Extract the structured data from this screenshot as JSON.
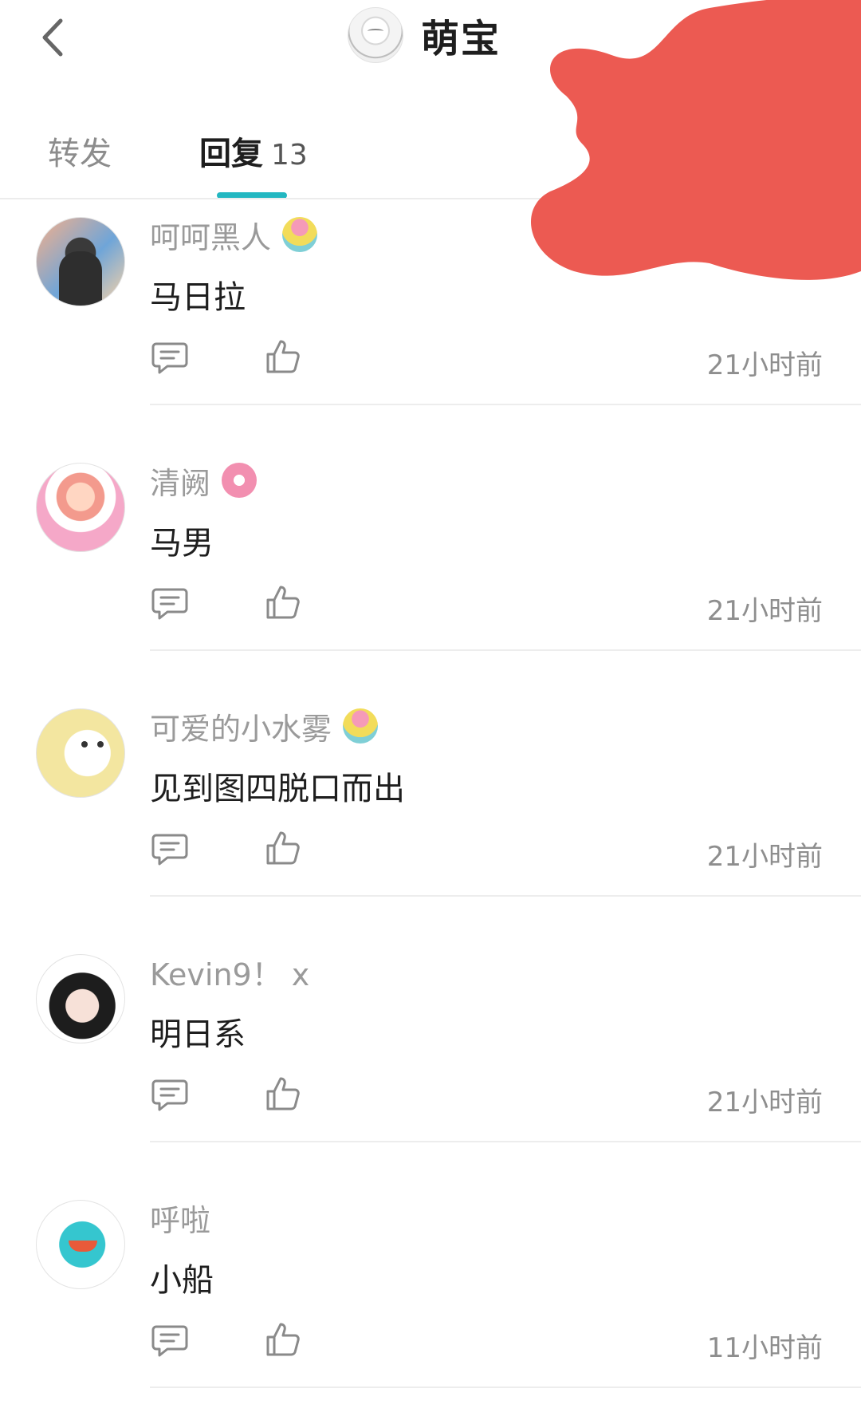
{
  "header": {
    "title": "萌宝",
    "back_icon": "chevron-left-icon",
    "avatar_icon": "user-avatar"
  },
  "tabs": [
    {
      "label": "转发",
      "count": ""
    },
    {
      "label": "回复",
      "count": "13"
    }
  ],
  "active_tab_color": "#23b7c1",
  "comments": [
    {
      "username": "呵呵黑人",
      "has_badge": true,
      "text": "马日拉",
      "time": "21小时前"
    },
    {
      "username": "清阙",
      "has_badge": true,
      "text": "马男",
      "time": "21小时前"
    },
    {
      "username": "可爱的小水雾",
      "has_badge": true,
      "text": "见到图四脱口而出",
      "time": "21小时前"
    },
    {
      "username": "Kevin9！ x",
      "has_badge": false,
      "text": "明日系",
      "time": "21小时前"
    },
    {
      "username": "呼啦",
      "has_badge": false,
      "text": "小船",
      "time": "11小时前"
    }
  ],
  "icons": {
    "reply": "comment-bubble-icon",
    "like": "thumbs-up-icon"
  },
  "colors": {
    "redaction": "#ec5a52",
    "muted_text": "#9a9a9a",
    "primary_text": "#1e1e1e"
  }
}
